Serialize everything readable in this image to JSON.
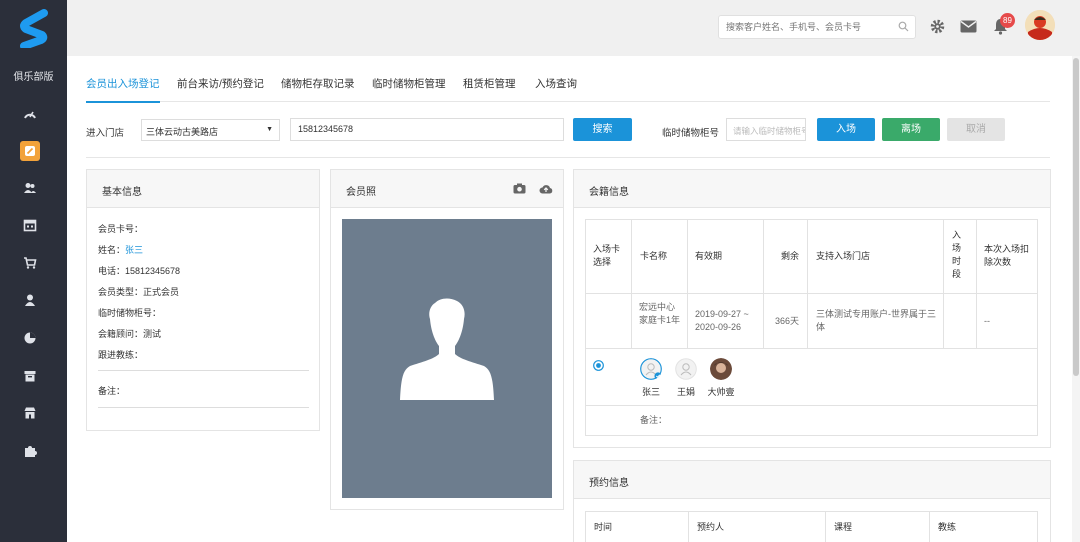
{
  "app": {
    "club_label": "俱乐部版"
  },
  "topbar": {
    "search_placeholder": "搜索客户姓名、手机号、会员卡号",
    "notification_count": "89"
  },
  "tabs": [
    {
      "label": "会员出入场登记",
      "active": true
    },
    {
      "label": "前台来访/预约登记"
    },
    {
      "label": "储物柜存取记录"
    },
    {
      "label": "临时储物柜管理"
    },
    {
      "label": "租赁柜管理"
    },
    {
      "label": "入场查询"
    }
  ],
  "form": {
    "store_label": "进入门店",
    "store_value": "三体云动古美路店",
    "phone_value": "15812345678",
    "search_button": "搜索",
    "locker_label": "临时储物柜号",
    "locker_placeholder": "请输入临时储物柜号",
    "enter_button": "入场",
    "leave_button": "离场",
    "cancel_button": "取消"
  },
  "basic": {
    "title": "基本信息",
    "card_no": "会员卡号：",
    "name_label": "姓名：",
    "name_value": "张三",
    "phone": "电话：15812345678",
    "type": "会员类型：正式会员",
    "locker": "临时储物柜号：",
    "advisor": "会籍顾问：测试",
    "coach": "跟进教练：",
    "note": "备注："
  },
  "photo": {
    "title": "会员照"
  },
  "membership": {
    "title": "会籍信息",
    "headers": [
      "入场卡选择",
      "卡名称",
      "有效期",
      "剩余",
      "支持入场门店",
      "入场时段",
      "本次入场扣除次数"
    ],
    "row": {
      "card_name": "宏远中心家庭卡1年",
      "validity": "2019-09-27 ~ 2020-09-26",
      "remaining": "366天",
      "stores": "三体测试专用账户-世界属于三体",
      "period": "",
      "deduct": "--"
    },
    "members": [
      "张三",
      "王娟",
      "大帅壹"
    ],
    "note": "备注："
  },
  "booking": {
    "title": "预约信息",
    "headers": [
      "时间",
      "预约人",
      "课程",
      "教练"
    ]
  },
  "colors": {
    "sidebar": "#2b2f3a",
    "accent": "#1b93d9",
    "green": "#3aaa6a",
    "orange": "#f2a23a",
    "badge": "#e64a4a"
  }
}
